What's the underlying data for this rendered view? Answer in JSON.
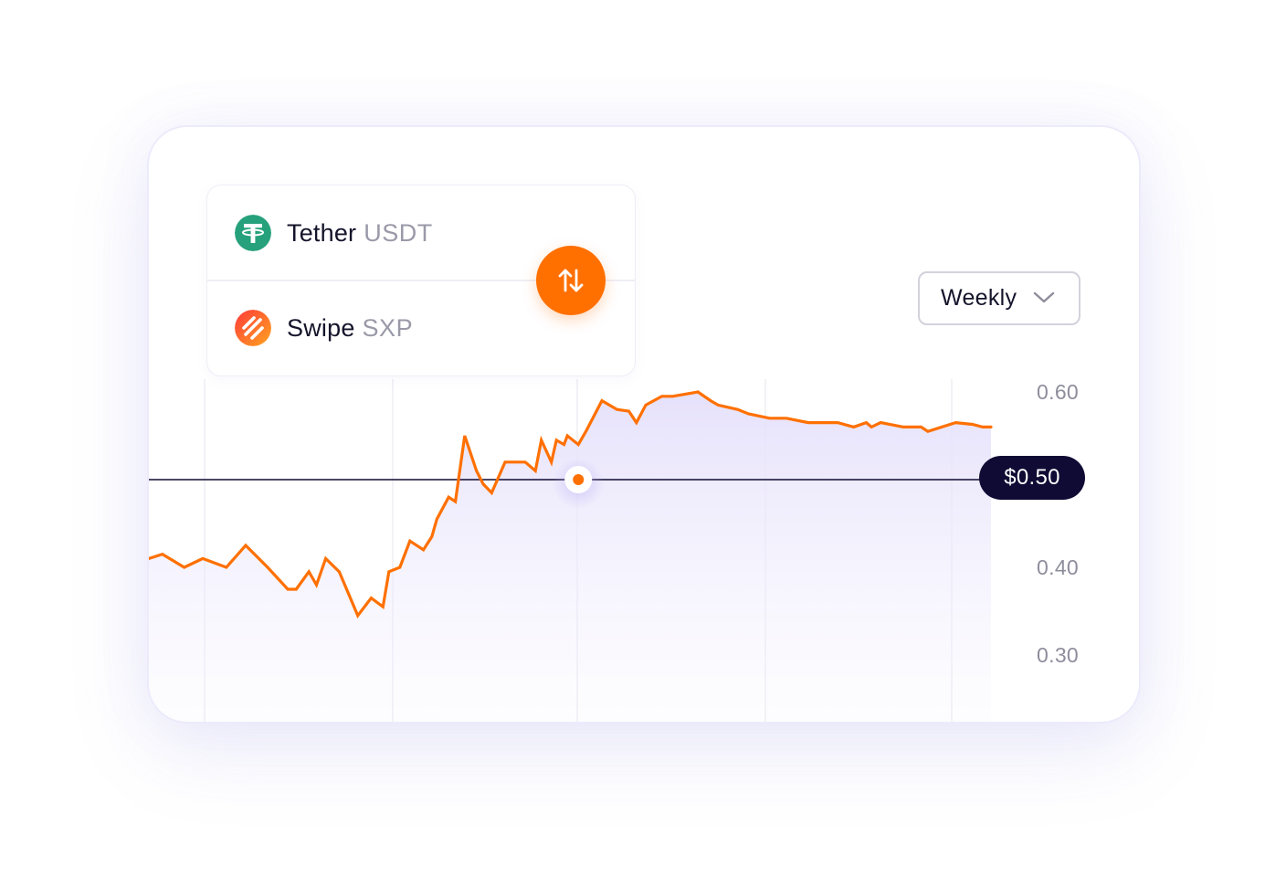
{
  "pair": {
    "base": {
      "name": "Tether",
      "ticker": "USDT",
      "icon": "tether-icon",
      "color": "#26a17b"
    },
    "quote": {
      "name": "Swipe",
      "ticker": "SXP",
      "icon": "swipe-icon",
      "color_from": "#ff3d3d",
      "color_to": "#ff9a1f"
    },
    "swap_icon": "swap-vertical-arrows-icon"
  },
  "period_select": {
    "value": "Weekly",
    "icon": "chevron-down-icon"
  },
  "current_price": {
    "label": "$0.50",
    "value": 0.5
  },
  "colors": {
    "line": "#ff7000",
    "area": "#ece8fc",
    "price_line": "#100b34",
    "accent": "#ff7000"
  },
  "chart_data": {
    "type": "area",
    "y_ticks": [
      "0.60",
      "0.40",
      "0.30"
    ],
    "y_tick_values": [
      0.6,
      0.4,
      0.3
    ],
    "ylim": [
      0.22,
      0.62
    ],
    "xlim": [
      0,
      1
    ],
    "grid": "vertical",
    "marker": {
      "x": 0.51,
      "y": 0.5
    },
    "x": [
      0.0,
      0.016,
      0.042,
      0.064,
      0.092,
      0.115,
      0.141,
      0.165,
      0.175,
      0.19,
      0.199,
      0.21,
      0.226,
      0.248,
      0.264,
      0.278,
      0.285,
      0.298,
      0.31,
      0.326,
      0.336,
      0.342,
      0.356,
      0.364,
      0.375,
      0.389,
      0.397,
      0.407,
      0.423,
      0.447,
      0.459,
      0.466,
      0.478,
      0.484,
      0.493,
      0.497,
      0.51,
      0.519,
      0.538,
      0.556,
      0.57,
      0.579,
      0.59,
      0.609,
      0.622,
      0.652,
      0.667,
      0.676,
      0.699,
      0.712,
      0.737,
      0.757,
      0.783,
      0.818,
      0.837,
      0.852,
      0.858,
      0.869,
      0.896,
      0.917,
      0.925,
      0.958,
      0.978,
      0.99,
      1.0
    ],
    "y": [
      0.41,
      0.415,
      0.4,
      0.41,
      0.4,
      0.425,
      0.4,
      0.375,
      0.375,
      0.395,
      0.38,
      0.41,
      0.395,
      0.345,
      0.365,
      0.355,
      0.395,
      0.4,
      0.43,
      0.42,
      0.435,
      0.455,
      0.48,
      0.475,
      0.55,
      0.51,
      0.495,
      0.485,
      0.52,
      0.52,
      0.51,
      0.545,
      0.52,
      0.545,
      0.54,
      0.55,
      0.54,
      0.555,
      0.59,
      0.58,
      0.578,
      0.565,
      0.585,
      0.595,
      0.595,
      0.6,
      0.59,
      0.585,
      0.58,
      0.575,
      0.57,
      0.57,
      0.565,
      0.565,
      0.56,
      0.565,
      0.56,
      0.565,
      0.56,
      0.56,
      0.555,
      0.565,
      0.563,
      0.56,
      0.56
    ]
  }
}
